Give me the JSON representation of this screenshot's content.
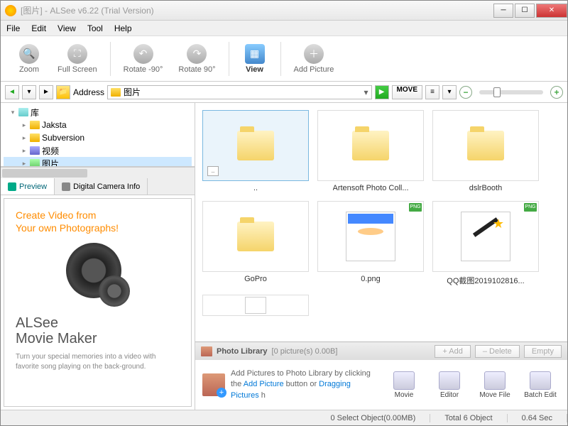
{
  "title": "[图片] - ALSee v6.22 (Trial Version)",
  "menu": {
    "file": "File",
    "edit": "Edit",
    "view": "View",
    "tool": "Tool",
    "help": "Help"
  },
  "toolbar": {
    "zoom": "Zoom",
    "full": "Full Screen",
    "rotn": "Rotate -90°",
    "rotp": "Rotate 90°",
    "view": "View",
    "add": "Add Picture"
  },
  "address": {
    "label": "Address",
    "value": "图片",
    "move": "MOVE"
  },
  "tree": {
    "root": "库",
    "items": [
      "Jaksta",
      "Subversion",
      "视频",
      "图片"
    ]
  },
  "tabs": {
    "preview": "Preview",
    "camera": "Digital Camera Info"
  },
  "promo": {
    "h1a": "Create Video from",
    "h1b": "Your own Photographs!",
    "h2a": "ALSee",
    "h2b": "Movie Maker",
    "p": "Turn your special memories into a video with favorite song playing on the back-ground."
  },
  "thumbs": [
    {
      "name": "..",
      "type": "up"
    },
    {
      "name": "Artensoft Photo Coll...",
      "type": "folder"
    },
    {
      "name": "dslrBooth",
      "type": "folder"
    },
    {
      "name": "GoPro",
      "type": "folder"
    },
    {
      "name": "0.png",
      "type": "png"
    },
    {
      "name": "QQ截图2019102816...",
      "type": "png"
    }
  ],
  "library": {
    "title": "Photo Library",
    "count": "[0 picture(s) 0.00B]",
    "add": "+  Add",
    "delete": "–  Delete",
    "empty": "Empty",
    "msg1": "Add Pictures to Photo Library by clicking the",
    "link1": "Add Picture",
    "msg2": " button or ",
    "link2": "Dragging Pictures",
    "msg3": " h"
  },
  "actions": {
    "movie": "Movie",
    "editor": "Editor",
    "movefile": "Move File",
    "batch": "Batch Edit"
  },
  "status": {
    "sel": "0 Select Object(0.00MB)",
    "total": "Total 6 Object",
    "time": "0.64 Sec"
  }
}
